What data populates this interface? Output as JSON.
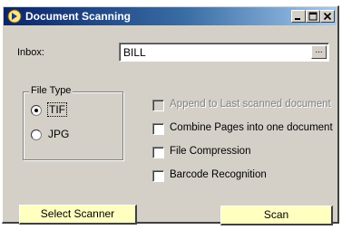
{
  "window": {
    "title": "Document Scanning",
    "icon": "scanner-app-icon",
    "controls": [
      "minimize",
      "maximize",
      "close"
    ]
  },
  "inbox": {
    "label": "Inbox:",
    "value": "BILL",
    "browse_label": "..."
  },
  "file_type": {
    "legend": "File Type",
    "options": [
      {
        "label": "TIF",
        "selected": true
      },
      {
        "label": "JPG",
        "selected": false
      }
    ]
  },
  "options": [
    {
      "label": "Append to Last scanned document",
      "checked": false,
      "enabled": false
    },
    {
      "label": "Combine Pages into one document",
      "checked": false,
      "enabled": true
    },
    {
      "label": "File Compression",
      "checked": false,
      "enabled": true
    },
    {
      "label": "Barcode Recognition",
      "checked": false,
      "enabled": true
    }
  ],
  "buttons": {
    "select_scanner": "Select Scanner",
    "scan": "Scan"
  },
  "colors": {
    "title_start": "#0a246a",
    "title_end": "#a6caf0",
    "button_face": "#ffffc0",
    "dialog_face": "#d4d0c8"
  }
}
